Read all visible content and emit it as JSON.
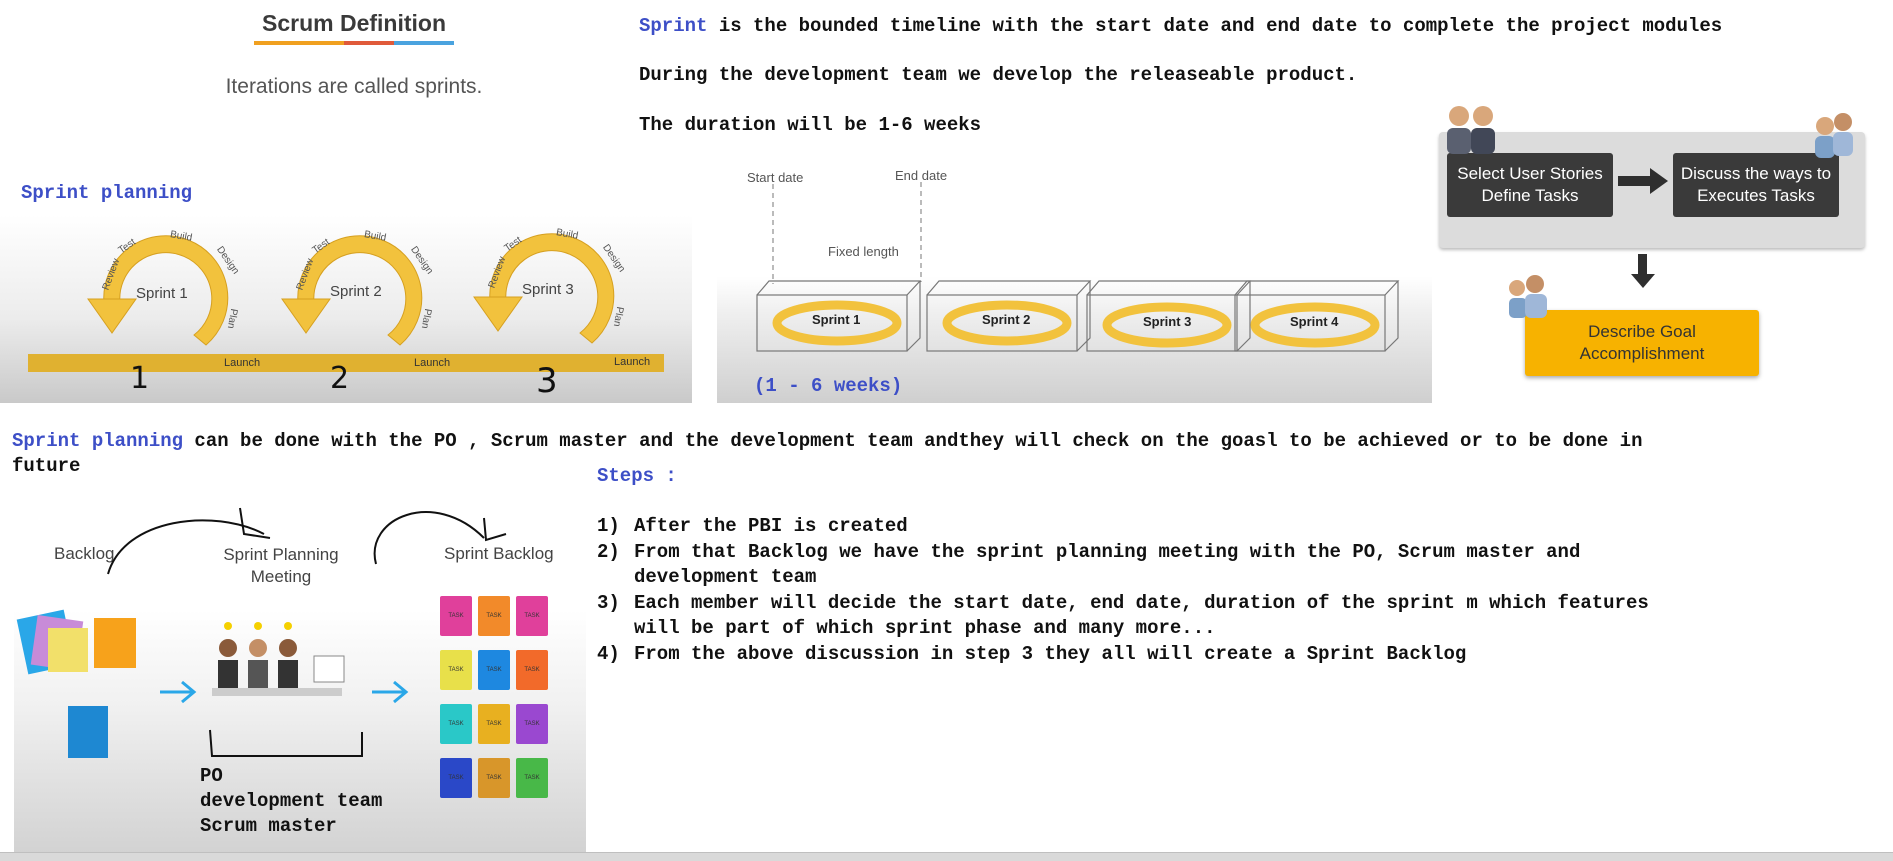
{
  "scrum_definition": {
    "title": "Scrum Definition",
    "subtitle": "Iterations are called sprints.",
    "colors": [
      "#f0a020",
      "#e05a3a",
      "#4aa3df"
    ]
  },
  "sprint_text": {
    "keyword": "Sprint",
    "line1_rest": " is the bounded timeline with the start date and end date to complete the project modules",
    "line2": "During the development team we develop the releaseable product.",
    "line3": "The duration will be 1-6 weeks"
  },
  "sprint_planning_label": "Sprint planning",
  "cycle_diagram": {
    "sprints": [
      "Sprint 1",
      "Sprint 2",
      "Sprint 3"
    ],
    "arrow_words": [
      "Review",
      "Test",
      "Build",
      "Design",
      "Plan"
    ],
    "launch": "Launch",
    "handwritten_numbers": [
      "1",
      "2",
      "3"
    ]
  },
  "timeline_diagram": {
    "start_label": "Start date",
    "end_label": "End date",
    "fixed_label": "Fixed length",
    "boxes": [
      "Sprint 1",
      "Sprint 2",
      "Sprint 3",
      "Sprint 4"
    ],
    "weeks_note": "(1 - 6 weeks)"
  },
  "flow_diagram": {
    "box1": "Select User Stories Define Tasks",
    "box2": "Discuss the ways to Executes Tasks",
    "box3": "Describe Goal Accomplishment"
  },
  "planning_sentence": {
    "keyword": "Sprint planning",
    "rest": " can be done with the PO , Scrum master and the development team andthey will check on the goasl to be achieved or to be done in",
    "wrap": "future"
  },
  "backlog_diagram": {
    "backlog": "Backlog",
    "meeting": "Sprint Planning Meeting",
    "sprint_backlog": "Sprint Backlog",
    "task": "TASK",
    "members": [
      "PO",
      "development team",
      "Scrum master"
    ]
  },
  "steps": {
    "heading": "Steps :",
    "items": [
      {
        "num": "1)",
        "lines": [
          "After the PBI is created"
        ]
      },
      {
        "num": "2)",
        "lines": [
          "From that Backlog we have the sprint planning meeting with the PO, Scrum master and",
          "development team"
        ]
      },
      {
        "num": "3)",
        "lines": [
          "Each member will decide the start date, end date, duration of the sprint m which features",
          "will be part of which sprint phase and many more..."
        ]
      },
      {
        "num": "4)",
        "lines": [
          "From the above discussion in step 3 they all will create a Sprint Backlog"
        ]
      }
    ]
  }
}
